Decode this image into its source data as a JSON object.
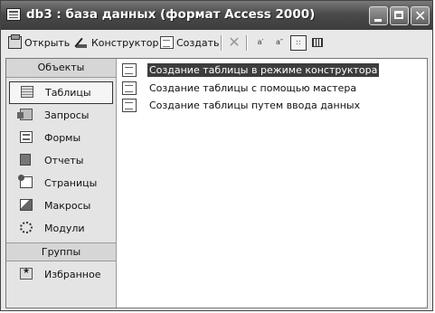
{
  "window": {
    "title": "db3 : база данных (формат Access 2000)"
  },
  "toolbar": {
    "open_label": "Открыть",
    "design_label": "Конструктор",
    "new_label": "Создать",
    "view_large_icons": "a′",
    "view_small_icons": "a″",
    "view_list": "∷"
  },
  "objects_header": "Объекты",
  "objects": [
    {
      "label": "Таблицы",
      "icon": "table-icon",
      "selected": true
    },
    {
      "label": "Запросы",
      "icon": "query-icon"
    },
    {
      "label": "Формы",
      "icon": "form-icon"
    },
    {
      "label": "Отчеты",
      "icon": "report-icon"
    },
    {
      "label": "Страницы",
      "icon": "page-icon"
    },
    {
      "label": "Макросы",
      "icon": "macro-icon"
    },
    {
      "label": "Модули",
      "icon": "module-icon"
    }
  ],
  "groups_header": "Группы",
  "groups": [
    {
      "label": "Избранное",
      "icon": "favorites-icon"
    }
  ],
  "shortcuts": [
    {
      "label": "Создание таблицы в режиме конструктора",
      "selected": true
    },
    {
      "label": "Создание таблицы с помощью мастера"
    },
    {
      "label": "Создание таблицы путем ввода данных"
    }
  ]
}
